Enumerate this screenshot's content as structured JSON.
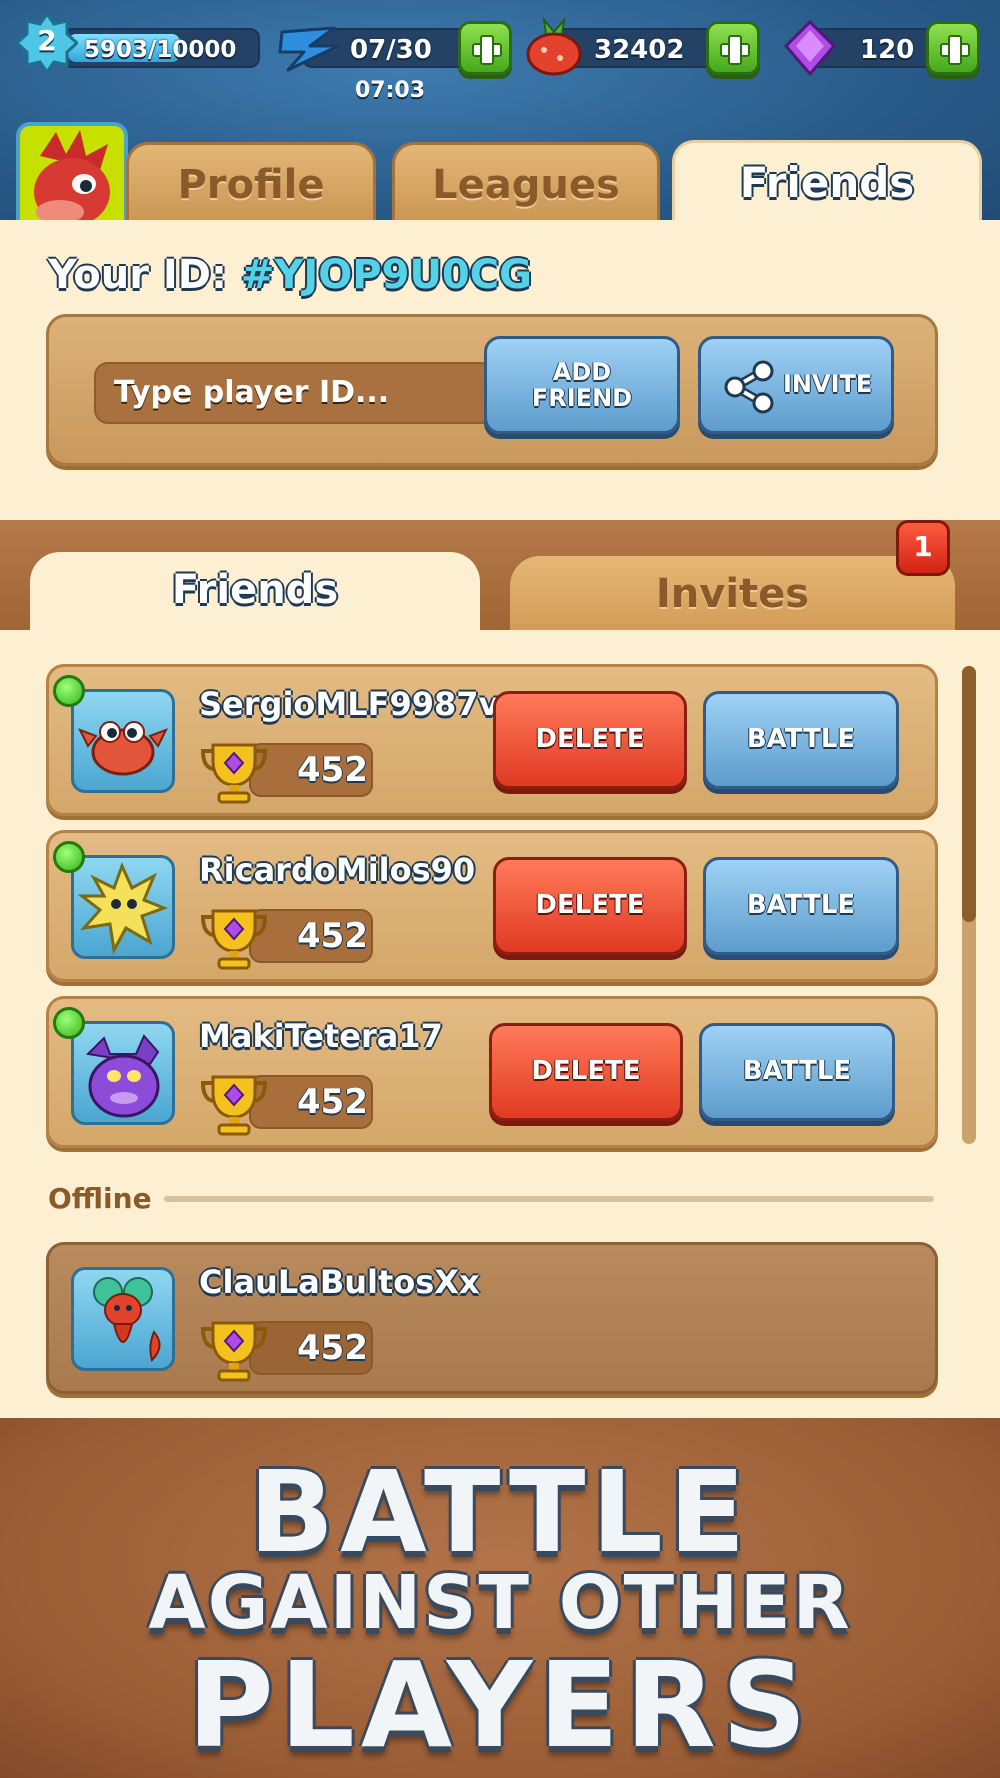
{
  "resources": {
    "level": "2",
    "xp": "5903/10000",
    "xp_progress": 0.5903,
    "energy": "07/30",
    "energy_timer": "07:03",
    "food": "32402",
    "gems": "120"
  },
  "tabs": [
    {
      "label": "Profile",
      "active": false
    },
    {
      "label": "Leagues",
      "active": false
    },
    {
      "label": "Friends",
      "active": true
    }
  ],
  "player_id": {
    "label": "Your ID:",
    "value": "#YJOP9U0CG"
  },
  "add_friend": {
    "placeholder": "Type player ID...",
    "add_label_line1": "ADD",
    "add_label_line2": "FRIEND",
    "invite_label": "INVITE"
  },
  "sub_tabs": [
    {
      "label": "Friends",
      "active": true
    },
    {
      "label": "Invites",
      "active": false,
      "badge": "1"
    }
  ],
  "friends_online": [
    {
      "name": "SergioMLF9987v",
      "trophies": "452",
      "delete_label": "DELETE",
      "battle_label": "BATTLE",
      "online": true
    },
    {
      "name": "RicardoMilos90",
      "trophies": "452",
      "delete_label": "DELETE",
      "battle_label": "BATTLE",
      "online": true
    },
    {
      "name": "MakiTetera17",
      "trophies": "452",
      "delete_label": "DELETE",
      "battle_label": "BATTLE",
      "online": true
    }
  ],
  "offline_label": "Offline",
  "friends_offline": [
    {
      "name": "ClauLaBultosXx",
      "trophies": "452",
      "online": false
    }
  ],
  "banner": {
    "line1": "BATTLE",
    "line2": "AGAINST OTHER",
    "line3": "PLAYERS"
  },
  "colors": {
    "panel": "#fdf0d2",
    "blue_button": "#5d9ccc",
    "red_button": "#e03a22",
    "plus_button": "#46a81e",
    "online_dot": "#35b516"
  }
}
